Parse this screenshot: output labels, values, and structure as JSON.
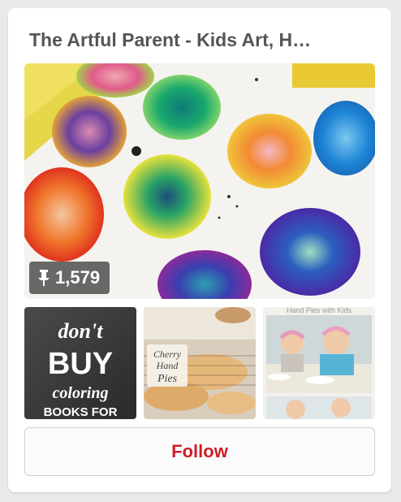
{
  "board": {
    "title": "The Artful Parent - Kids Art, H…",
    "pin_count": "1,579"
  },
  "thumbnails": {
    "chalkboard_lines": [
      "don't",
      "BUY",
      "coloring",
      "BOOKS FOR"
    ],
    "pies_label_lines": [
      "Cherry",
      "Hand",
      "Pies"
    ],
    "kids_caption": "Hand Pies with Kids"
  },
  "follow_button": {
    "label": "Follow"
  },
  "colors": {
    "follow_text": "#cb2027",
    "title_text": "#555555"
  },
  "icons": {
    "pin": "pushpin-icon"
  }
}
